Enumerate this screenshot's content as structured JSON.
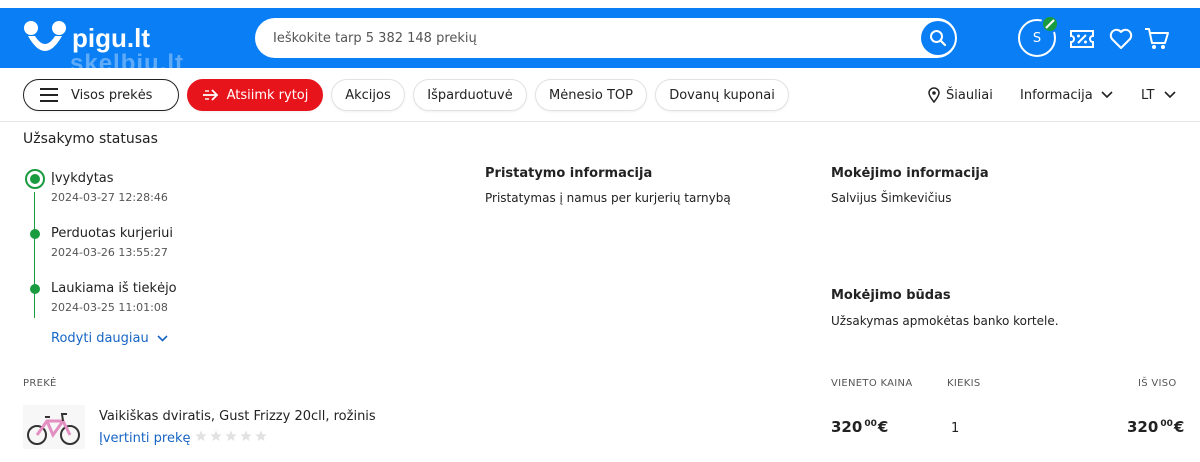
{
  "header": {
    "logo_text": "pigu.lt",
    "watermark": "skelbiu.lt",
    "search_placeholder": "Ieškokite tarp 5 382 148 prekių",
    "avatar_initial": "S"
  },
  "nav": {
    "all_products": "Visos prekės",
    "pickup_tomorrow": "Atsiimk rytoj",
    "pills": [
      "Akcijos",
      "Išparduotuvė",
      "Mėnesio TOP",
      "Dovanų kuponai"
    ],
    "location": "Šiauliai",
    "info": "Informacija",
    "language": "LT"
  },
  "order": {
    "title": "Užsakymo statusas",
    "statuses": [
      {
        "label": "Įvykdytas",
        "date": "2024-03-27 12:28:46"
      },
      {
        "label": "Perduotas kurjeriui",
        "date": "2024-03-26 13:55:27"
      },
      {
        "label": "Laukiama iš tiekėjo",
        "date": "2024-03-25 11:01:08"
      }
    ],
    "show_more": "Rodyti daugiau",
    "delivery": {
      "heading": "Pristatymo informacija",
      "text": "Pristatymas į namus per kurjerių tarnybą"
    },
    "payment": {
      "heading": "Mokėjimo informacija",
      "text": "Salvijus Šimkevičius"
    },
    "payment_method": {
      "heading": "Mokėjimo būdas",
      "text": "Užsakymas apmokėtas banko kortele."
    }
  },
  "table": {
    "columns": {
      "product": "PREKĖ",
      "unit_price": "VIENETO KAINA",
      "quantity": "KIEKIS",
      "total": "IŠ VISO"
    },
    "rows": [
      {
        "name": "Vaikiškas dviratis, Gust Frizzy 20cll, rožinis",
        "rate_label": "Įvertinti prekę",
        "rating": 0,
        "unit_price_main": "320",
        "unit_price_cents": "00",
        "currency": "€",
        "quantity": "1",
        "total_main": "320",
        "total_cents": "00"
      }
    ]
  },
  "colors": {
    "brand_blue": "#0a7ff5",
    "accent_red": "#e8141c",
    "status_green": "#1a9b3f",
    "link_blue": "#1765c4"
  }
}
